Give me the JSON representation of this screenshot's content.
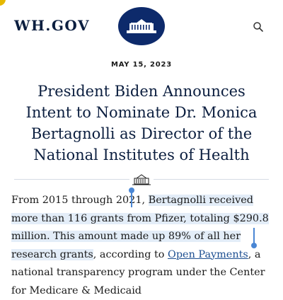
{
  "header": {
    "logo": "WH.GOV",
    "seal_icon": "white-house-seal",
    "search_icon": "search-icon",
    "colors": {
      "navy": "#0b1e3f",
      "seal": "#0d2a6b",
      "link": "#1d4f91",
      "selection": "#4a86d4"
    }
  },
  "article": {
    "date": "MAY 15, 2023",
    "title_lines": [
      "President Biden Announces",
      "Intent to Nominate Dr. Monica",
      "Bertagnolli as Director of the",
      "National Institutes of Health"
    ],
    "divider_icon": "white-house-icon",
    "paragraph": {
      "part1": "From 2015 through 2021, ",
      "part2": "Bertagnolli received more than 116 grants from Pfizer, totaling $290.8 million. This amount made up 89% of all her research grants",
      "part3": ", according to ",
      "link": "Open Payments",
      "part4": ", a national transparency program under the Center for Medicare & Medicaid"
    }
  }
}
